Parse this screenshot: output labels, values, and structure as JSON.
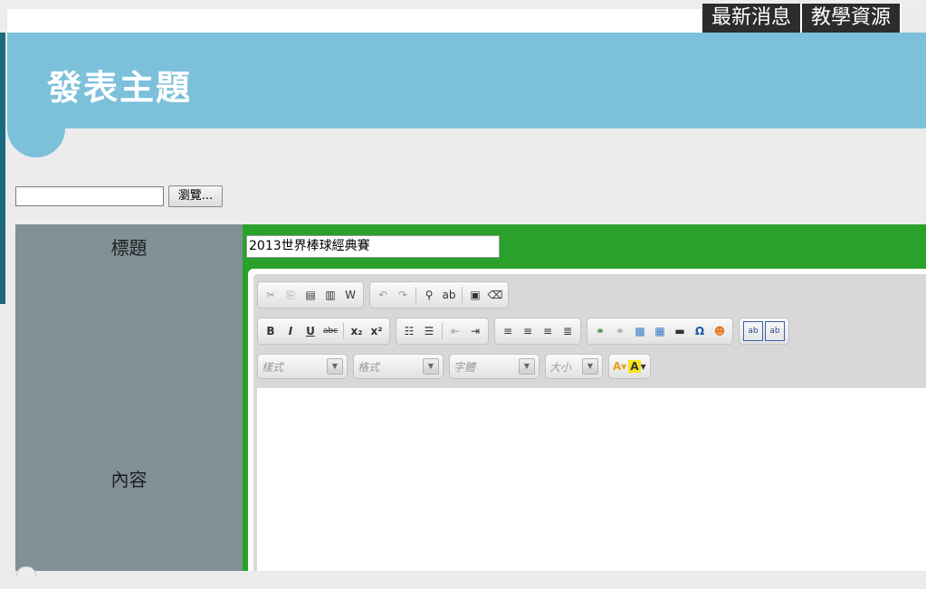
{
  "nav": {
    "items": [
      "最新消息",
      "教學資源"
    ]
  },
  "header": {
    "title": "發表主題"
  },
  "file_upload": {
    "value": "",
    "browse_label": "瀏覽..."
  },
  "form": {
    "title_label": "標題",
    "title_value": "2013世界棒球經典賽",
    "content_label": "內容"
  },
  "editor": {
    "toolbar1": [
      {
        "icon": "cut-icon",
        "glyph": "✂"
      },
      {
        "icon": "copy-icon",
        "glyph": "⎘"
      },
      {
        "icon": "paste-icon",
        "glyph": "📋"
      },
      {
        "icon": "paste-text-icon",
        "glyph": "📄"
      },
      {
        "icon": "paste-word-icon",
        "glyph": "W"
      },
      {
        "icon": "undo-icon",
        "glyph": "↶"
      },
      {
        "icon": "redo-icon",
        "glyph": "↷"
      },
      {
        "icon": "find-icon",
        "glyph": "🔍"
      },
      {
        "icon": "replace-icon",
        "glyph": "ab"
      },
      {
        "icon": "select-all-icon",
        "glyph": "▣"
      },
      {
        "icon": "remove-format-icon",
        "glyph": "⌫"
      }
    ],
    "formatting": [
      {
        "icon": "bold-icon",
        "glyph": "B"
      },
      {
        "icon": "italic-icon",
        "glyph": "I"
      },
      {
        "icon": "underline-icon",
        "glyph": "U"
      },
      {
        "icon": "strike-icon",
        "glyph": "abc"
      },
      {
        "icon": "subscript-icon",
        "glyph": "x₂"
      },
      {
        "icon": "superscript-icon",
        "glyph": "x²"
      }
    ],
    "lists": [
      {
        "icon": "numbered-list-icon",
        "glyph": "≡"
      },
      {
        "icon": "bullet-list-icon",
        "glyph": "☰"
      },
      {
        "icon": "outdent-icon",
        "glyph": "⇤"
      },
      {
        "icon": "indent-icon",
        "glyph": "⇥"
      }
    ],
    "align": [
      {
        "icon": "align-left-icon",
        "glyph": "≡"
      },
      {
        "icon": "align-center-icon",
        "glyph": "≡"
      },
      {
        "icon": "align-right-icon",
        "glyph": "≡"
      },
      {
        "icon": "align-justify-icon",
        "glyph": "≡"
      }
    ],
    "insert": [
      {
        "icon": "link-icon",
        "glyph": "🔗"
      },
      {
        "icon": "unlink-icon",
        "glyph": "⛓"
      },
      {
        "icon": "image-icon",
        "glyph": "🖼"
      },
      {
        "icon": "table-icon",
        "glyph": "▦"
      },
      {
        "icon": "horizontal-rule-icon",
        "glyph": "―"
      },
      {
        "icon": "special-char-icon",
        "glyph": "Ω"
      },
      {
        "icon": "smiley-icon",
        "glyph": "☺"
      }
    ],
    "fields": [
      {
        "icon": "text-field-icon",
        "glyph": "ab"
      },
      {
        "icon": "textarea-icon",
        "glyph": "ab"
      }
    ],
    "combos": {
      "styles": "樣式",
      "format": "格式",
      "font": "字體",
      "size": "大小"
    },
    "text_color": "A",
    "bg_color": "A"
  },
  "colors": {
    "banner": "#7cc0da",
    "label_column": "#7f9097",
    "value_column": "#2aa12a",
    "nav_bg": "#2c2c2c"
  }
}
